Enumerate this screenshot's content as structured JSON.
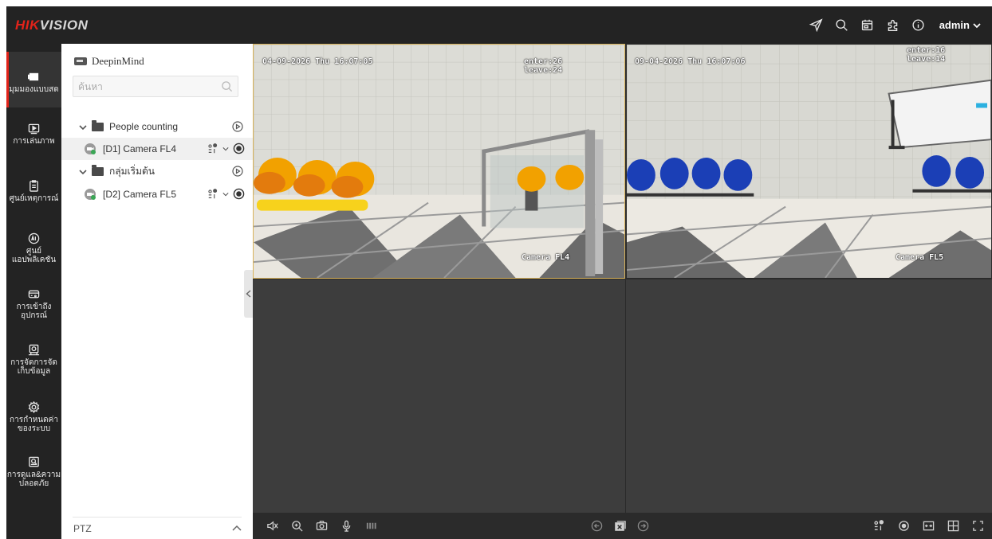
{
  "header": {
    "logo_red": "HIK",
    "logo_gray": "VISION",
    "username": "admin",
    "icons": [
      "send-icon",
      "search-icon",
      "calendar-icon",
      "puzzle-icon",
      "info-icon"
    ]
  },
  "nav": {
    "items": [
      {
        "label": "มุมมองแบบสด",
        "icon": "live-view-icon",
        "active": true
      },
      {
        "label": "การเล่นภาพ",
        "icon": "playback-icon"
      },
      {
        "label": "ศูนย์เหตุการณ์",
        "icon": "event-center-icon"
      },
      {
        "label_line1": "ศูนย์",
        "label_line2": "แอปพลิเคชัน",
        "icon": "ai-icon"
      },
      {
        "label_line1": "การเข้าถึง",
        "label_line2": "อุปกรณ์",
        "icon": "device-icon"
      },
      {
        "label_line1": "การจัดการจัด",
        "label_line2": "เก็บข้อมูล",
        "icon": "storage-icon"
      },
      {
        "label_line1": "การกำหนดค่า",
        "label_line2": "ของระบบ",
        "icon": "settings-icon"
      },
      {
        "label_line1": "การดูแล&ความ",
        "label_line2": "ปลอดภัย",
        "icon": "maintenance-icon"
      }
    ]
  },
  "tree": {
    "device_name": "DeepinMind",
    "search_placeholder": "ค้นหา",
    "groups": [
      {
        "name": "People counting",
        "camera": "[D1] Camera FL4"
      },
      {
        "name": "กลุ่มเริ่มต้น",
        "camera": "[D2] Camera FL5"
      }
    ],
    "ptz_label": "PTZ"
  },
  "videos": [
    {
      "timestamp": "04-09-2026 Thu 16:07:05",
      "counter": "enter:26\nleave:24",
      "camera_label": "Camera FL4"
    },
    {
      "timestamp": "09-04-2026 Thu 16:07:06",
      "counter": "enter:16\nleave:14",
      "camera_label": "Camera FL5"
    }
  ],
  "toolbar": {
    "left": [
      "audio-off-icon",
      "zoom-in-icon",
      "snapshot-icon",
      "microphone-icon",
      "stream-bars-icon"
    ],
    "center": [
      "previous-page-icon",
      "close-all-icon",
      "next-page-icon"
    ],
    "right": [
      "people-count-icon",
      "record-icon",
      "fit-window-icon",
      "layout-grid-icon",
      "fullscreen-icon"
    ]
  },
  "colors": {
    "accent": "#e2231a",
    "selected_border": "#d9b35a"
  }
}
